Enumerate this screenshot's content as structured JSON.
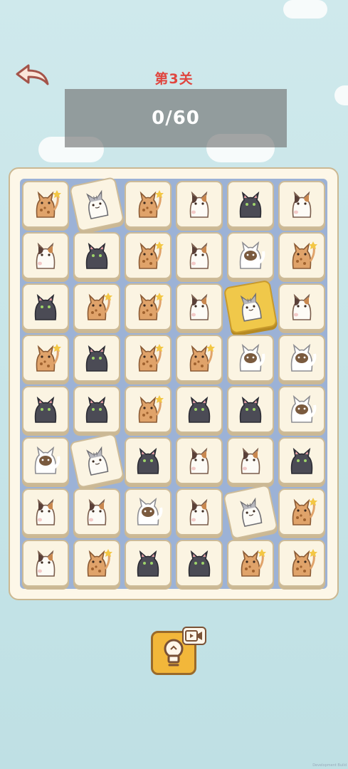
{
  "level_title": "第3关",
  "progress": {
    "text": "0/60",
    "matched": 0,
    "total": 60
  },
  "watermark": "Development Build",
  "board": {
    "rows": 8,
    "cols": 6,
    "tiles": [
      [
        "bengal",
        "gray-tabby",
        "bengal",
        "calico",
        "black",
        "calico"
      ],
      [
        "calico",
        "black",
        "bengal",
        "calico",
        "white-hood",
        "bengal"
      ],
      [
        "black",
        "bengal",
        "bengal",
        "calico",
        "gray-tabby",
        "calico"
      ],
      [
        "bengal",
        "black",
        "bengal",
        "bengal",
        "white-hood",
        "white-hood"
      ],
      [
        "black",
        "black",
        "bengal",
        "black",
        "black",
        "white-hood"
      ],
      [
        "white-hood",
        "gray-tabby",
        "black",
        "calico",
        "calico",
        "black"
      ],
      [
        "calico",
        "calico",
        "white-hood",
        "calico",
        "gray-tabby",
        "bengal"
      ],
      [
        "calico",
        "bengal",
        "black",
        "black",
        "bengal",
        "bengal"
      ]
    ],
    "selected": [
      [
        2,
        4
      ]
    ],
    "tilted": [
      [
        0,
        1
      ],
      [
        5,
        1
      ],
      [
        6,
        4
      ]
    ]
  },
  "icons": {
    "back": "back-arrow-icon",
    "hint": "lightbulb-icon",
    "video": "video-play-icon"
  },
  "colors": {
    "level_title": "#e0463f",
    "tile": "#fbf4e2",
    "tile_selected": "#f0c84a",
    "board_inner": "#9cb2d6",
    "hint_button": "#f2b73a"
  }
}
